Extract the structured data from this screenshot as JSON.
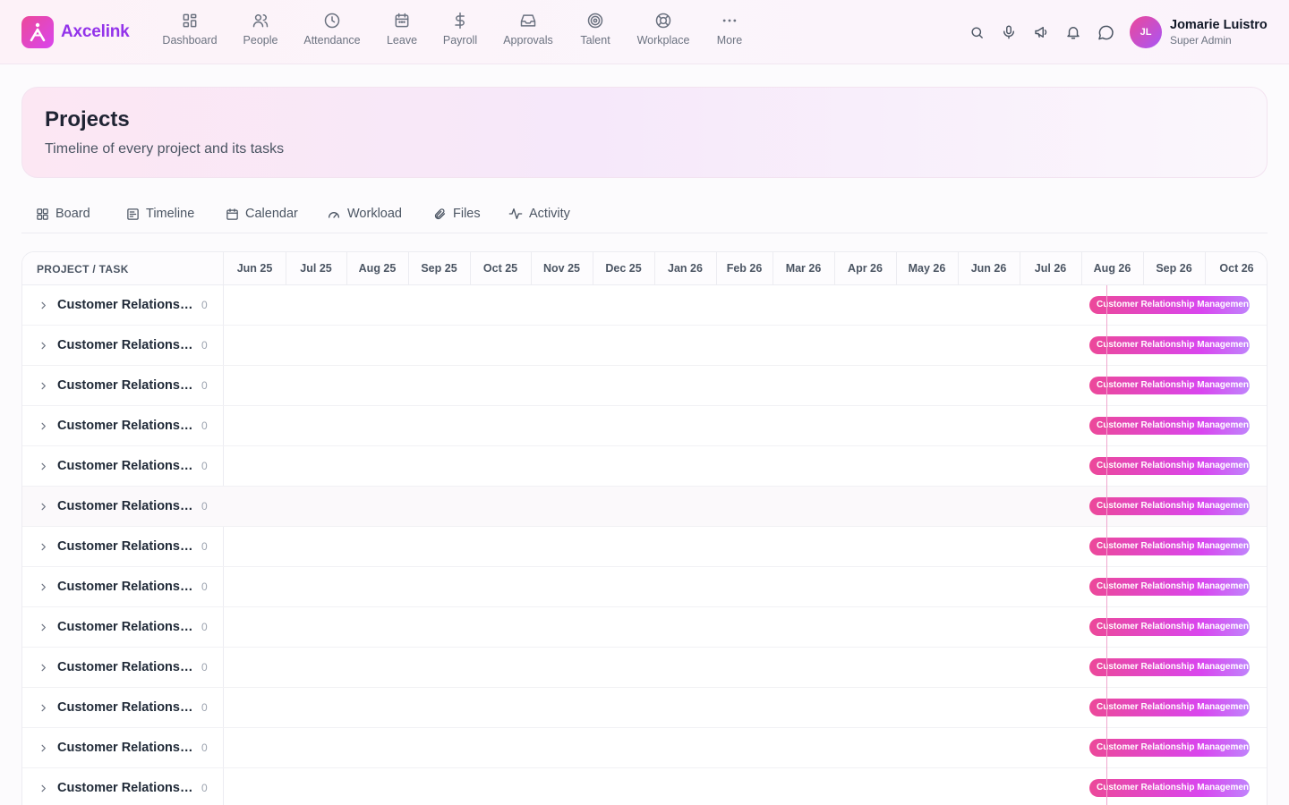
{
  "brand": {
    "name": "Axcelink"
  },
  "nav": [
    {
      "label": "Dashboard",
      "icon": "dashboard-icon"
    },
    {
      "label": "People",
      "icon": "people-icon"
    },
    {
      "label": "Attendance",
      "icon": "clock-icon"
    },
    {
      "label": "Leave",
      "icon": "calendar-icon"
    },
    {
      "label": "Payroll",
      "icon": "dollar-icon"
    },
    {
      "label": "Approvals",
      "icon": "inbox-icon"
    },
    {
      "label": "Talent",
      "icon": "target-icon"
    },
    {
      "label": "Workplace",
      "icon": "lifebuoy-icon"
    },
    {
      "label": "More",
      "icon": "more-icon"
    }
  ],
  "toolbar_icons": [
    "search-icon",
    "microphone-icon",
    "megaphone-icon",
    "bell-icon",
    "chat-icon"
  ],
  "user": {
    "initials": "JL",
    "name": "Jomarie Luistro",
    "role": "Super Admin"
  },
  "page": {
    "title": "Projects",
    "subtitle": "Timeline of every project and its tasks"
  },
  "view_tabs": [
    {
      "label": "Board",
      "icon": "grid-icon"
    },
    {
      "label": "Timeline",
      "icon": "timeline-icon"
    },
    {
      "label": "Calendar",
      "icon": "calendar-icon"
    },
    {
      "label": "Workload",
      "icon": "gauge-icon"
    },
    {
      "label": "Files",
      "icon": "paperclip-icon"
    },
    {
      "label": "Activity",
      "icon": "activity-icon"
    }
  ],
  "timeline": {
    "column_title": "PROJECT / TASK",
    "months": [
      "Jun 25",
      "Jul 25",
      "Aug 25",
      "Sep 25",
      "Oct 25",
      "Nov 25",
      "Dec 25",
      "Jan 26",
      "Feb 26",
      "Mar 26",
      "Apr 26",
      "May 26",
      "Jun 26",
      "Jul 26",
      "Aug 26",
      "Sep 26",
      "Oct 26"
    ],
    "rows": [
      {
        "name": "Customer Relationsh...",
        "count": "0",
        "bar_label": "Customer Relationship Management"
      },
      {
        "name": "Customer Relationsh...",
        "count": "0",
        "bar_label": "Customer Relationship Management"
      },
      {
        "name": "Customer Relationsh...",
        "count": "0",
        "bar_label": "Customer Relationship Management"
      },
      {
        "name": "Customer Relationsh...",
        "count": "0",
        "bar_label": "Customer Relationship Management"
      },
      {
        "name": "Customer Relationsh...",
        "count": "0",
        "bar_label": "Customer Relationship Management"
      },
      {
        "name": "Customer Relationsh...",
        "count": "0",
        "bar_label": "Customer Relationship Management"
      },
      {
        "name": "Customer Relationsh...",
        "count": "0",
        "bar_label": "Customer Relationship Management"
      },
      {
        "name": "Customer Relationsh...",
        "count": "0",
        "bar_label": "Customer Relationship Management"
      },
      {
        "name": "Customer Relationsh...",
        "count": "0",
        "bar_label": "Customer Relationship Management"
      },
      {
        "name": "Customer Relationsh...",
        "count": "0",
        "bar_label": "Customer Relationship Management"
      },
      {
        "name": "Customer Relationsh...",
        "count": "0",
        "bar_label": "Customer Relationship Management"
      },
      {
        "name": "Customer Relationsh...",
        "count": "0",
        "bar_label": "Customer Relationship Management"
      },
      {
        "name": "Customer Relationsh...",
        "count": "0",
        "bar_label": "Customer Relationship Management"
      }
    ]
  }
}
